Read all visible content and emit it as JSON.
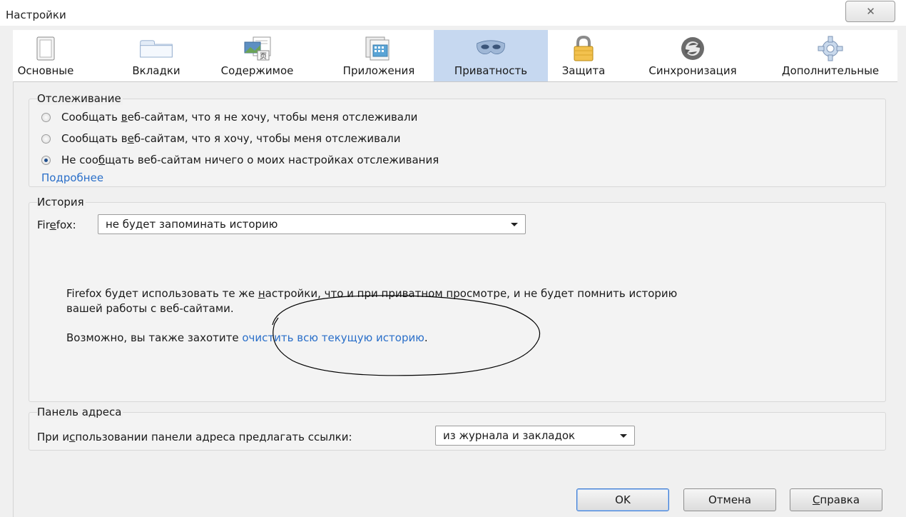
{
  "window": {
    "title": "Настройки",
    "close_label": "✕"
  },
  "tabs": [
    {
      "label": "Основные",
      "icon": "switch-icon"
    },
    {
      "label": "Вкладки",
      "icon": "tabs-icon"
    },
    {
      "label": "Содержимое",
      "icon": "content-icon"
    },
    {
      "label": "Приложения",
      "icon": "applications-icon"
    },
    {
      "label": "Приватность",
      "icon": "mask-icon",
      "selected": true
    },
    {
      "label": "Защита",
      "icon": "lock-icon"
    },
    {
      "label": "Синхронизация",
      "icon": "sync-icon"
    },
    {
      "label": "Дополнительные",
      "icon": "gear-icon"
    }
  ],
  "tracking": {
    "title": "Отслеживание",
    "options": [
      {
        "pre": "Сообщать ",
        "u": "в",
        "post": "еб-сайтам, что я не хочу, чтобы меня отслеживали",
        "checked": false
      },
      {
        "pre": "Сообщать в",
        "u": "е",
        "post": "б-сайтам, что я хочу, чтобы меня отслеживали",
        "checked": false
      },
      {
        "pre": "Не соо",
        "u": "б",
        "post": "щать веб-сайтам ничего о моих настройках отслеживания",
        "checked": true
      }
    ],
    "more_link": "Подробнее"
  },
  "history": {
    "title": "История",
    "firefox_label_pre": "Fir",
    "firefox_label_u": "e",
    "firefox_label_post": "fox:",
    "select_value": "не будет запоминать историю",
    "info_line1_pre": "Firefox будет использовать те же ",
    "info_line1_u": "н",
    "info_line1_post": "астройки, что и при приватном просмотре, и не будет помнить историю",
    "info_line2": "вашей работы с веб-сайтами.",
    "clear_pre": "Возможно, вы также захотите ",
    "clear_link": "очистить всю текущую историю",
    "clear_post": "."
  },
  "addressbar": {
    "title": "Панель адреса",
    "label_pre": "При и",
    "label_u": "с",
    "label_post": "пользовании панели адреса предлагать ссылки:",
    "select_value": "из журнала и закладок"
  },
  "buttons": {
    "ok": "OK",
    "cancel": "Отмена",
    "help_u": "С",
    "help_post": "правка"
  },
  "colors": {
    "selected_tab": "#c6d8f0",
    "link": "#2a6fc9"
  }
}
